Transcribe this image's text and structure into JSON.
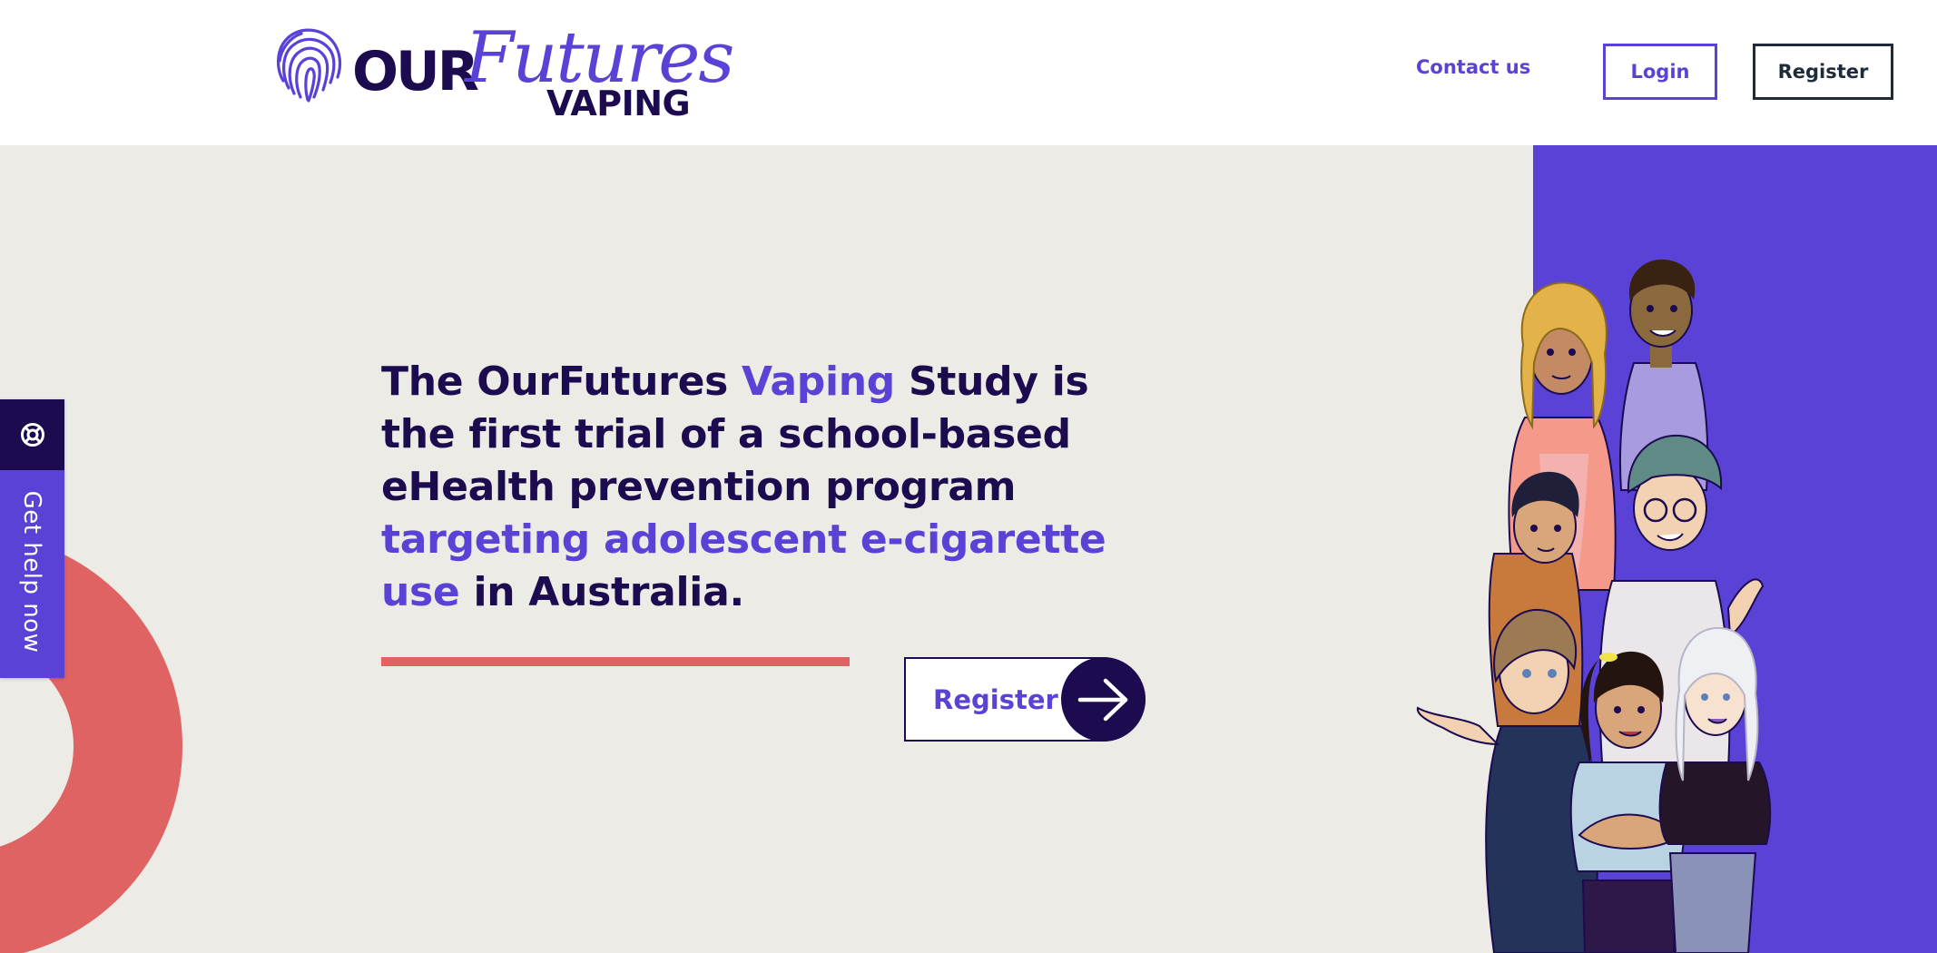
{
  "header": {
    "logo": {
      "our": "OUR",
      "futures": "Futures",
      "vaping": "VAPING"
    },
    "nav": {
      "contact_label": "Contact us",
      "login_label": "Login",
      "register_label": "Register"
    }
  },
  "help_tab": {
    "label": "Get help now",
    "icon": "lifebuoy-icon"
  },
  "hero": {
    "segments": [
      "The OurFutures ",
      "Vaping",
      " Study is the first trial of a school-based eHealth prevention program ",
      "targeting adolescent e-cigarette use",
      " in Australia."
    ],
    "cta_label": "Register",
    "cta_icon": "arrow-right-icon"
  },
  "colors": {
    "brand_purple": "#5b42d6",
    "navy": "#1c0b4f",
    "coral": "#e06363",
    "background": "#edebe5"
  }
}
